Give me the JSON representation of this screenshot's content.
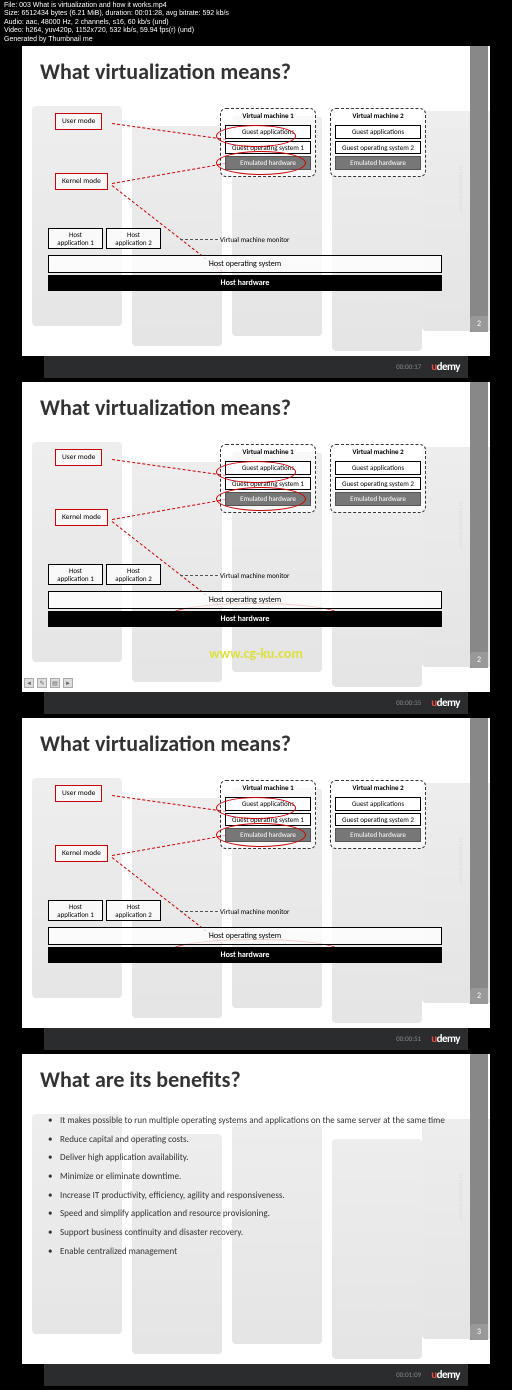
{
  "meta": {
    "line1": "File: 003 What is virtualization and how it works.mp4",
    "line2": "Size: 6512434 bytes (6.21 MiB), duration: 00:01:28, avg bitrate: 592 kb/s",
    "line3": "Audio: aac, 48000 Hz, 2 channels, s16, 60 kb/s (und)",
    "line4": "Video: h264, yuv420p, 1152x720, 532 kb/s, 59.94 fps(r) (und)",
    "line5": "Generated by Thumbnail me"
  },
  "diagram": {
    "user_mode": "User mode",
    "kernel_mode": "Kernel mode",
    "vm1_label": "Virtual machine 1",
    "vm2_label": "Virtual machine 2",
    "guest_apps": "Guest applications",
    "guest_os1": "Guest operating system 1",
    "guest_os2": "Guest operating system 2",
    "emu_hw": "Emulated hardware",
    "host_app1": "Host application 1",
    "host_app2": "Host application 2",
    "vmm": "Virtual machine monitor",
    "host_os": "Host operating system",
    "host_hw": "Host hardware"
  },
  "slides": {
    "title_virt": "What virtualization means?",
    "title_benefits": "What are its benefits?",
    "sidebar_text": "www.ituniversity.ro",
    "logo": "udemy"
  },
  "timestamps": {
    "t1": "00:00:17",
    "t2": "00:00:35",
    "t3": "00:00:51",
    "t4": "00:01:09"
  },
  "pages": {
    "p2": "2",
    "p3": "3"
  },
  "watermark": "www.cg-ku.com",
  "benefits": {
    "b1": "It makes possible to run multiple operating systems and applications on the same server at the same time",
    "b2": "Reduce capital and operating costs.",
    "b3": "Deliver high application availability.",
    "b4": "Minimize or eliminate downtime.",
    "b5": "Increase IT productivity, efficiency, agility and responsiveness.",
    "b6": "Speed and simplify application and resource provisioning.",
    "b7": "Support business continuity and disaster recovery.",
    "b8": "Enable centralized management"
  }
}
